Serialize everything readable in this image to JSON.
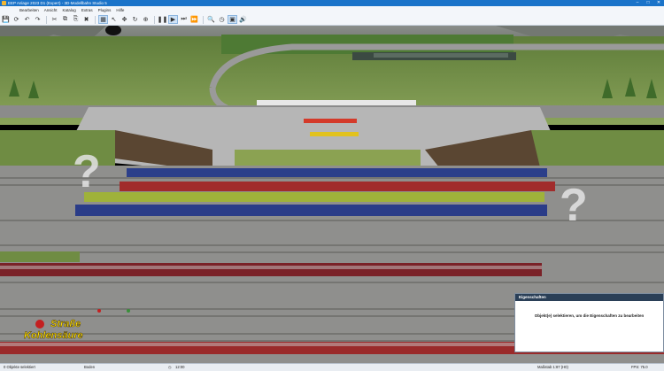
{
  "window": {
    "title": "EEP Anlage 2023 D1 (Expert) - 3D-Modellbahn Studio 5"
  },
  "menubar": {
    "menus": [
      "Bearbeiten",
      "Ansicht",
      "Katalog",
      "Extras",
      "Plugins",
      "Hilfe"
    ]
  },
  "toolbar": {
    "icons": [
      "save-icon",
      "rotate-icon",
      "undo-icon",
      "redo-icon",
      "cut-icon",
      "copy-icon",
      "paste-icon",
      "delete-icon",
      "select-icon",
      "pointer-icon",
      "move-icon",
      "rotate-tool-icon",
      "crosshair-icon",
      "play-icon",
      "pause-icon",
      "step-icon",
      "fast-forward-icon",
      "zoom-icon",
      "clock-icon",
      "sound-icon"
    ]
  },
  "viewport": {
    "sign_line1": "Straße",
    "sign_line2": "Kohlensäure"
  },
  "properties_panel": {
    "title": "Eigenschaften",
    "message": "Objekt(e) selektieren, um die Eigenschaften zu bearbeiten"
  },
  "statusbar": {
    "selected": "0 Objekte selektiert",
    "layer": "Boden",
    "time": "12:00",
    "scale": "Maßstab 1:87 (H0)",
    "fps": "FPS: 75.0"
  },
  "colors": {
    "accent": "#1a73c9",
    "sign_text": "#ffde00",
    "panel_header": "#2a3f57"
  }
}
